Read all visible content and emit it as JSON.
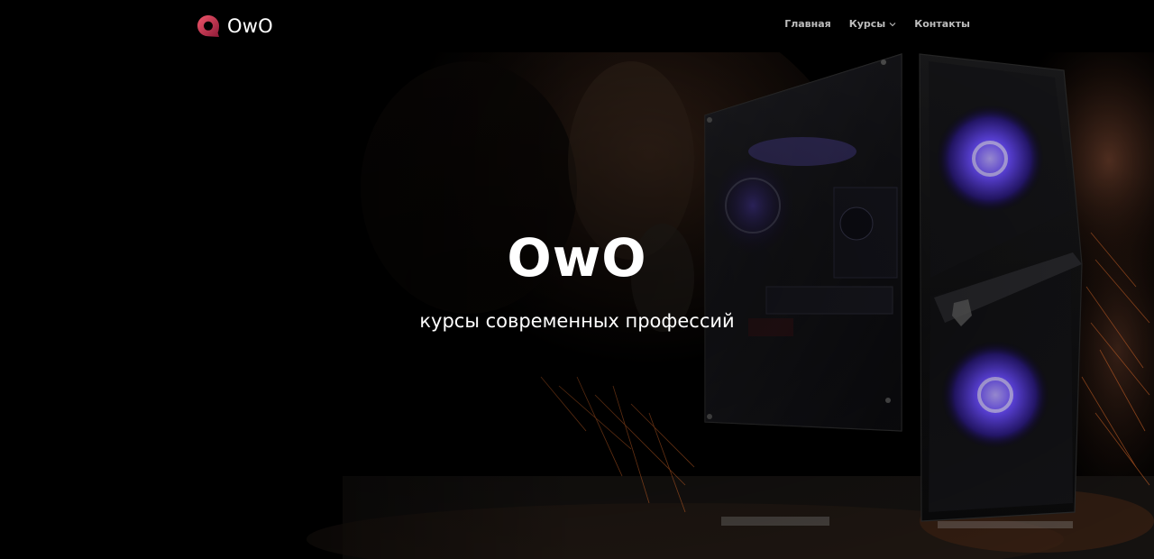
{
  "header": {
    "logo_text": "OwO",
    "logo_icon": "chat-bubble-logo-icon",
    "nav": [
      {
        "label": "Главная"
      },
      {
        "label": "Курсы",
        "has_dropdown": true,
        "icon": "chevron-down-icon"
      },
      {
        "label": "Контакты"
      }
    ]
  },
  "hero": {
    "title": "OwO",
    "subtitle": "курсы современных профессий"
  },
  "colors": {
    "background": "#000000",
    "brand_gradient_start": "#e0405a",
    "brand_gradient_end": "#9a1f3c",
    "nav_text": "#bdbdbd",
    "fan_glow": "#5a3cff",
    "sparks": "#ff7a2e"
  }
}
